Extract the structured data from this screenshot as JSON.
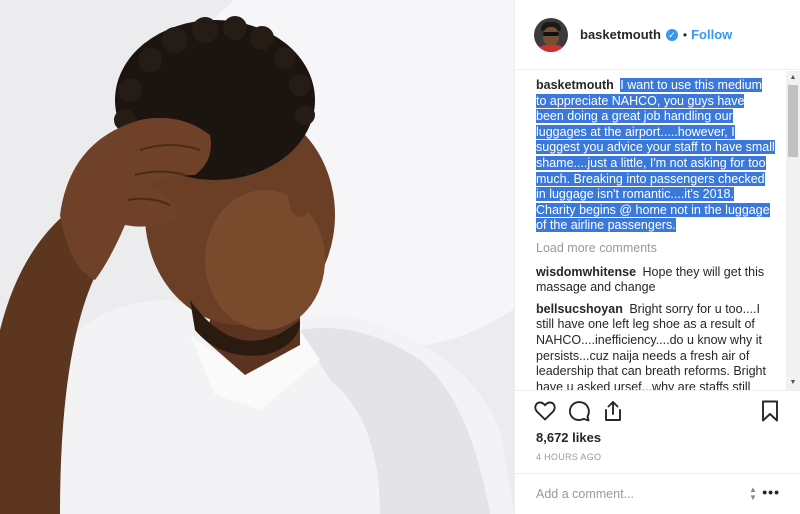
{
  "post": {
    "username": "basketmouth",
    "follow_label": "Follow",
    "separator": "•"
  },
  "caption": {
    "username": "basketmouth",
    "text": "I want to use this medium to appreciate NAHCO, you guys have been doing a great job handling our luggages at the airport.....however, I suggest you advice your staff to have small shame....just a little, I'm not asking for too much. Breaking into passengers checked in luggage isn't romantic....it's 2018. Charity begins @ home not in the luggage of the airline passengers."
  },
  "load_more_label": "Load more comments",
  "comments": [
    {
      "username": "wisdomwhitense",
      "text": "Hope they will get this massage and change"
    },
    {
      "username": "bellsucshoyan",
      "text": "Bright sorry for u too....I still have one left leg shoe as a result of NAHCO....inefficiency....do u know why it persists...cuz naija needs a fresh air of leadership that can breath reforms. Bright have u asked ursef...why are staffs still"
    }
  ],
  "likes_text": "8,672 likes",
  "timestamp": "4 HOURS AGO",
  "comment_input": {
    "placeholder": "Add a comment..."
  },
  "icons": {
    "like": "heart-icon",
    "comment": "speech-bubble-icon",
    "share": "share-icon",
    "save": "bookmark-icon",
    "verified": "verified-badge-icon",
    "more": "more-options-icon"
  },
  "colors": {
    "accent": "#3897f0",
    "selection": "#3b78dc",
    "muted_text": "#999999",
    "text": "#262626"
  }
}
